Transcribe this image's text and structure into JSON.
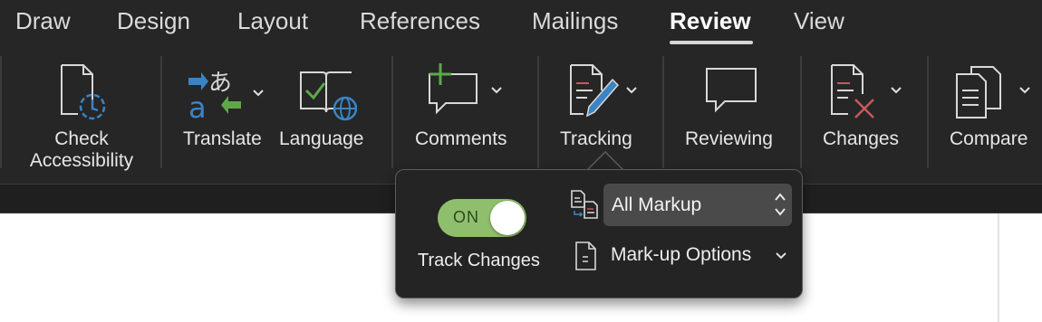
{
  "tabs": {
    "draw": "Draw",
    "design": "Design",
    "layout": "Layout",
    "references": "References",
    "mailings": "Mailings",
    "review": "Review",
    "view": "View",
    "active": "Review"
  },
  "ribbon": {
    "check_accessibility_line1": "Check",
    "check_accessibility_line2": "Accessibility",
    "translate": "Translate",
    "language": "Language",
    "comments": "Comments",
    "tracking": "Tracking",
    "reviewing": "Reviewing",
    "changes": "Changes",
    "compare": "Compare"
  },
  "tracking_popover": {
    "toggle_state": "ON",
    "track_changes_label": "Track Changes",
    "markup_select_value": "All Markup",
    "markup_options_label": "Mark-up Options"
  },
  "colors": {
    "accent_blue": "#3b84c4",
    "accent_green": "#5fa84a",
    "toggle_on": "#8fbf6d",
    "delete_red": "#c65a5a"
  }
}
